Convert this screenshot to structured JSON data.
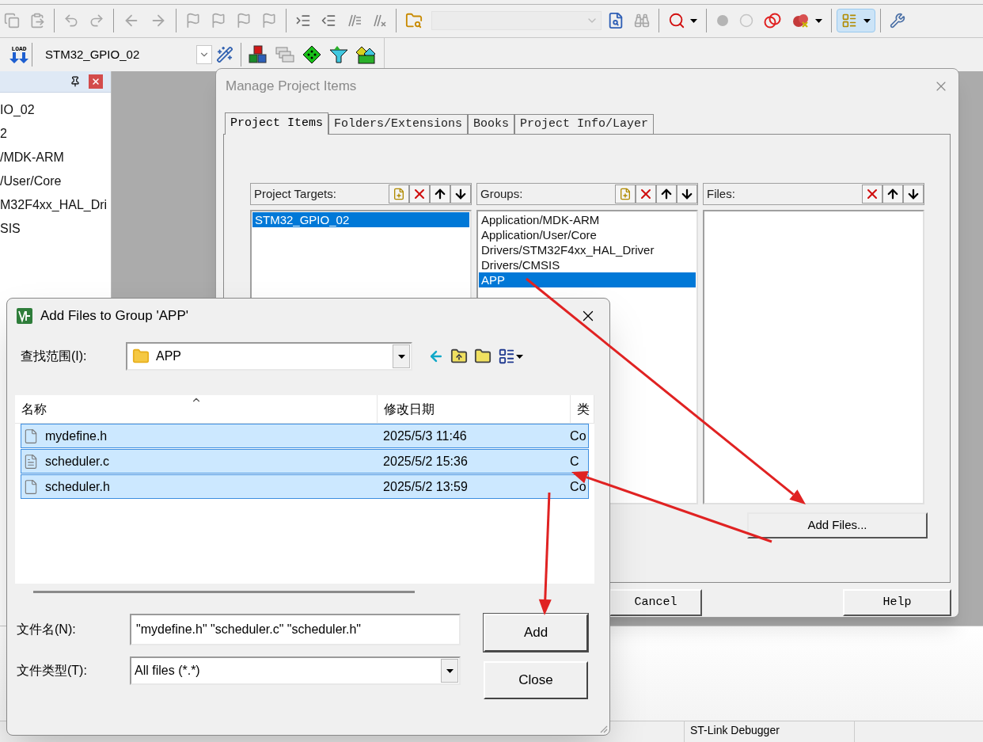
{
  "toolbar": {
    "load_button": "LOAD",
    "target_select": "STM32_GPIO_02"
  },
  "project_panel": {
    "items": [
      "IO_02",
      "2",
      "/MDK-ARM",
      "/User/Core",
      "M32F4xx_HAL_Dri",
      "SIS"
    ]
  },
  "manage_dialog": {
    "title": "Manage Project Items",
    "tabs": [
      {
        "label": "Project Items",
        "selected": true
      },
      {
        "label": "Folders/Extensions",
        "selected": false
      },
      {
        "label": "Books",
        "selected": false
      },
      {
        "label": "Project Info/Layer",
        "selected": false
      }
    ],
    "lists": [
      {
        "kind": "targets",
        "label": "Project Targets:",
        "items": [
          {
            "label": "STM32_GPIO_02",
            "selected": true
          }
        ]
      },
      {
        "kind": "groups",
        "label": "Groups:",
        "items": [
          {
            "label": "Application/MDK-ARM",
            "selected": false
          },
          {
            "label": "Application/User/Core",
            "selected": false
          },
          {
            "label": "Drivers/STM32F4xx_HAL_Driver",
            "selected": false
          },
          {
            "label": "Drivers/CMSIS",
            "selected": false
          },
          {
            "label": "APP",
            "selected": true
          }
        ]
      },
      {
        "kind": "files",
        "label": "Files:"
      }
    ],
    "add_files_button": "Add Files...",
    "buttons": [
      "Cancel",
      "Help"
    ]
  },
  "add_dialog": {
    "title": "Add Files to Group 'APP'",
    "look_in_label": "查找范围(I):",
    "look_in_value": "APP",
    "columns": [
      "名称",
      "修改日期",
      "类"
    ],
    "rows": [
      {
        "kind": "header",
        "name": "mydefine.h",
        "date": "2025/5/3 11:46",
        "type": "Co",
        "selected": true
      },
      {
        "kind": "source",
        "name": "scheduler.c",
        "date": "2025/5/2 15:36",
        "type": "C",
        "selected": true
      },
      {
        "kind": "header",
        "name": "scheduler.h",
        "date": "2025/5/2 13:59",
        "type": "Co",
        "selected": true
      }
    ],
    "filename_label": "文件名(N):",
    "filename_value": "\"mydefine.h\" \"scheduler.c\" \"scheduler.h\"",
    "filetype_label": "文件类型(T):",
    "filetype_value": "All files (*.*)",
    "buttons": [
      "Add",
      "Close"
    ]
  },
  "status_bar": {
    "debugger": "ST-Link Debugger"
  }
}
